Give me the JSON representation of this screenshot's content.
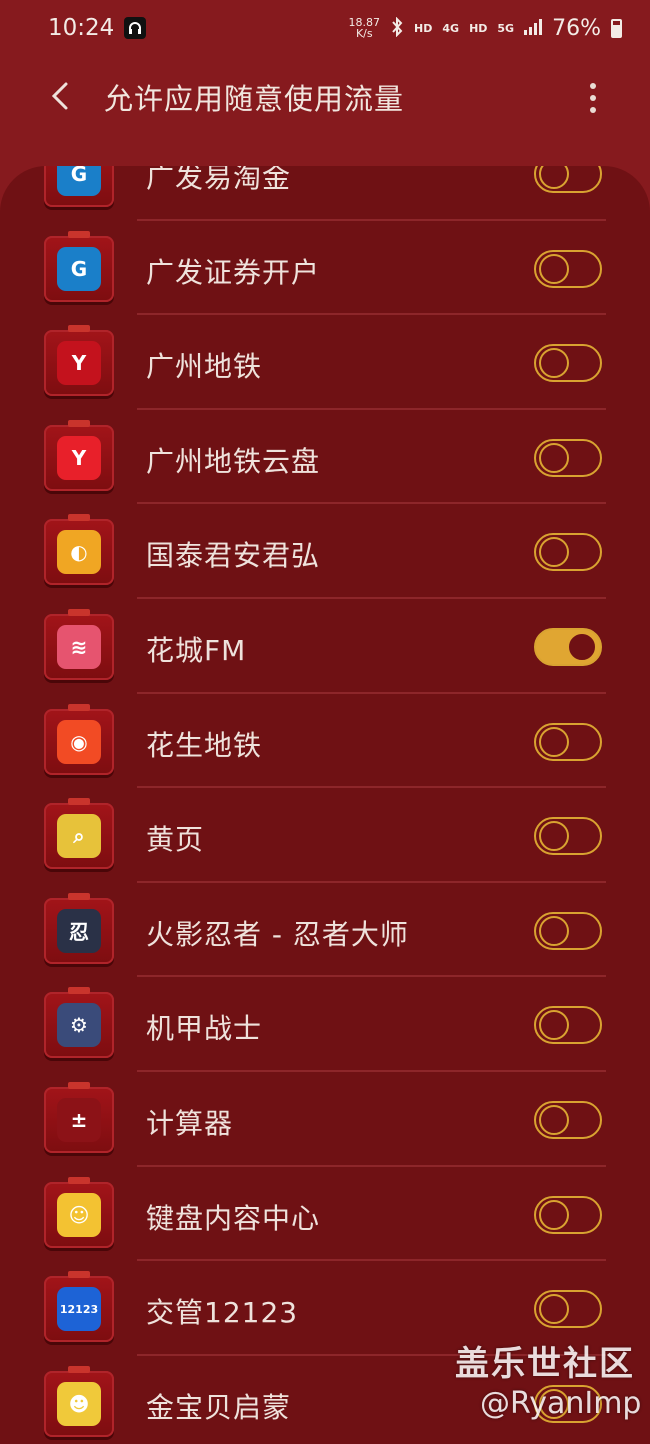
{
  "status_bar": {
    "time": "10:24",
    "net_speed_value": "18.87",
    "net_speed_unit": "K/s",
    "hd1": "HD",
    "net1": "4G",
    "hd2": "HD",
    "net2": "5G",
    "battery": "76%"
  },
  "header": {
    "title": "允许应用随意使用流量"
  },
  "apps": [
    {
      "label": "广发易淘金",
      "on": false,
      "icon": "gf-taojin-icon",
      "color": "#1a7fc9",
      "glyph": "G"
    },
    {
      "label": "广发证券开户",
      "on": false,
      "icon": "gf-securities-icon",
      "color": "#1a7fc9",
      "glyph": "G"
    },
    {
      "label": "广州地铁",
      "on": false,
      "icon": "gz-metro-icon",
      "color": "#c4121d",
      "glyph": "Y"
    },
    {
      "label": "广州地铁云盘",
      "on": false,
      "icon": "gz-metro-cloud-icon",
      "color": "#e8202a",
      "glyph": "Y"
    },
    {
      "label": "国泰君安君弘",
      "on": false,
      "icon": "gtja-icon",
      "color": "#f0a623",
      "glyph": "◐"
    },
    {
      "label": "花城FM",
      "on": true,
      "icon": "huacheng-fm-icon",
      "color": "#e6546f",
      "glyph": "≋"
    },
    {
      "label": "花生地铁",
      "on": false,
      "icon": "huasheng-metro-icon",
      "color": "#f24b24",
      "glyph": "◉"
    },
    {
      "label": "黄页",
      "on": false,
      "icon": "yellow-pages-icon",
      "color": "#e7c23a",
      "glyph": "⌕"
    },
    {
      "label": "火影忍者 - 忍者大师",
      "on": false,
      "icon": "naruto-icon",
      "color": "#2a3147",
      "glyph": "忍"
    },
    {
      "label": "机甲战士",
      "on": false,
      "icon": "mecha-icon",
      "color": "#3a4b7a",
      "glyph": "⚙"
    },
    {
      "label": "计算器",
      "on": false,
      "icon": "calculator-icon",
      "color": "#8c1217",
      "glyph": "±"
    },
    {
      "label": "键盘内容中心",
      "on": false,
      "icon": "keyboard-content-icon",
      "color": "#f3c232",
      "glyph": "☺"
    },
    {
      "label": "交管12123",
      "on": false,
      "icon": "traffic-12123-icon",
      "color": "#1d63d6",
      "glyph": "12123"
    },
    {
      "label": "金宝贝启蒙",
      "on": false,
      "icon": "gymboree-icon",
      "color": "#f0c93a",
      "glyph": "☻"
    }
  ],
  "watermark": {
    "line1": "盖乐世社区",
    "line2": "@RyanImp"
  }
}
